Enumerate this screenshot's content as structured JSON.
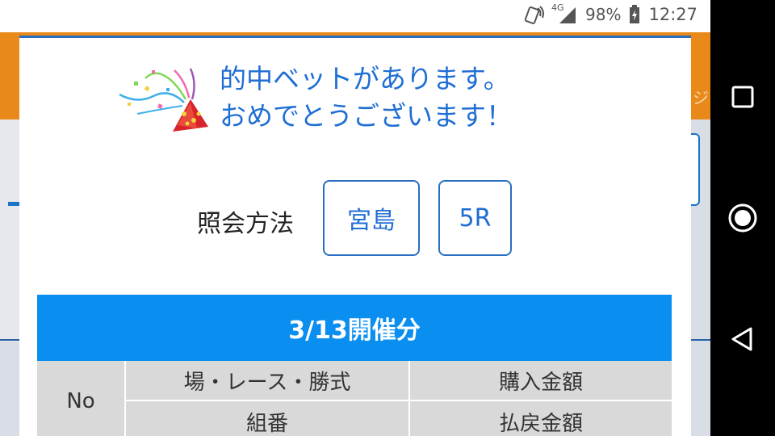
{
  "status_bar": {
    "network": "4G",
    "battery": "98%",
    "time": "12:27"
  },
  "background": {
    "partial_text": "ジ"
  },
  "modal": {
    "headline_line1": "的中ベットがあります。",
    "headline_line2": "おめでとうございます！",
    "query_label": "照会方法",
    "venue_button": "宮島",
    "race_button": "5R",
    "date_header": "3/13開催分",
    "table": {
      "col_no": "No",
      "col_venue_race_type": "場・レース・勝式",
      "col_purchase_amount": "購入金額",
      "col_combination": "組番",
      "col_refund_amount": "払戻金額"
    }
  },
  "icons": {
    "party_popper": "party-popper-icon",
    "recent_apps": "recent-apps-icon",
    "home": "home-icon",
    "back": "back-icon"
  },
  "colors": {
    "accent_blue": "#1f6ed4",
    "header_blue": "#0a8ef0",
    "orange": "#e8891a"
  }
}
